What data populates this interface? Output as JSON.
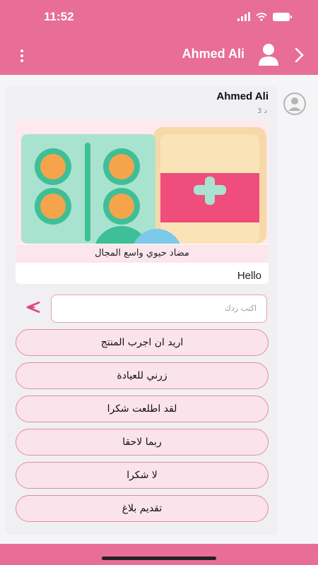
{
  "status_bar": {
    "time": "11:52"
  },
  "header": {
    "title": "Ahmed Ali"
  },
  "message": {
    "sender": "Ahmed Ali",
    "time": "3 د",
    "image_caption": "مضاد حيوي واسع المجال",
    "text": "Hello"
  },
  "reply": {
    "placeholder": "اكتب ردك"
  },
  "quick_replies": [
    "اريد ان اجرب المنتج",
    "زرني للعيادة",
    "لقد اطلعت شكرا",
    "ربما لاحقا",
    "لا شكرا",
    "تقديم بلاغ"
  ],
  "colors": {
    "accent": "#e86d97",
    "chip_bg": "#fae3ea",
    "chip_border": "#e58aa8"
  },
  "icons": [
    "menu-icon",
    "user-icon",
    "back-chevron-icon",
    "avatar-icon",
    "send-icon"
  ]
}
